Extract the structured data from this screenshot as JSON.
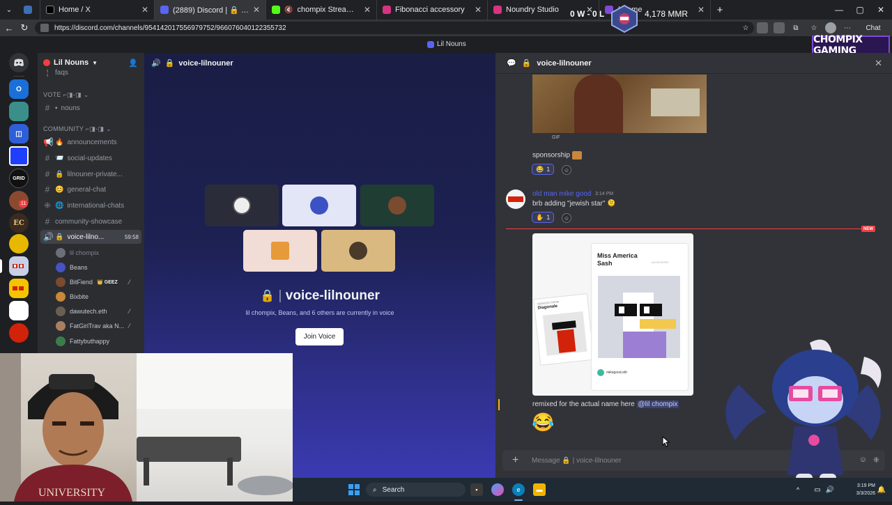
{
  "browser": {
    "tabs": [
      {
        "title": "Home / X",
        "color": "#000000"
      },
      {
        "title": "(2889) Discord | 🔒 | voice-lilnoun",
        "color": "#5865f2"
      },
      {
        "title": "chompix Stream - Watch Live",
        "color": "#53fc18"
      },
      {
        "title": "Fibonacci accessory",
        "color": "#d63384"
      },
      {
        "title": "Noundry Studio",
        "color": "#d63384"
      },
      {
        "title": "/ Home",
        "color": "#7d4bd6"
      }
    ],
    "url": "https://discord.com/channels/954142017556979752/966076040122355732"
  },
  "stream_overlay": {
    "win_loss": "0 W - 0 L",
    "mmr": "4,178 MMR",
    "brand": "CHOMPIX GAMING"
  },
  "discord": {
    "top_title": "Lil Nouns",
    "server_name": "Lil Nouns",
    "sidebar": {
      "partial_channel": "faqs",
      "categories": [
        "VOTE ⌐◨-◨",
        "COMMUNITY ⌐◨-◨"
      ],
      "channels": [
        {
          "label": "nouns",
          "icon": "#"
        },
        {
          "label": "announcements",
          "icon": "📢"
        },
        {
          "label": "social-updates",
          "icon": "#"
        },
        {
          "label": "lilnouner-private...",
          "icon": "#"
        },
        {
          "label": "general-chat",
          "icon": "#"
        },
        {
          "label": "international-chats",
          "icon": "#"
        },
        {
          "label": "community-showcase",
          "icon": "#"
        },
        {
          "label": "voice-lilno...",
          "icon": "🔊",
          "time": "59:58"
        }
      ],
      "voice_users": [
        {
          "name": "lil chompix",
          "color": "#6d6f78"
        },
        {
          "name": "Beans",
          "color": "#4752c4"
        },
        {
          "name": "BitFiend",
          "badge": "👑 GEEZ",
          "color": "#7a4b2e"
        },
        {
          "name": "Bixbite",
          "color": "#c9873a"
        },
        {
          "name": "dawutech.eth",
          "color": "#6a5f52"
        },
        {
          "name": "FatGirlTrav aka N...",
          "color": "#a97f62"
        },
        {
          "name": "Fattybuthappy",
          "color": "#3a7d4a"
        }
      ]
    },
    "voice_stage": {
      "header": "voice-lilnouner",
      "title": "voice-lilnouner",
      "subtitle": "lil chompix, Beans, and 6 others are currently in voice",
      "join_label": "Join Voice"
    },
    "chat": {
      "header": "voice-lilnouner",
      "gif_label": "GIF",
      "message_1": "sponsorship",
      "reaction_1_count": "1",
      "author_2": "old man mike good",
      "time_2": "3:14 PM",
      "message_2": "brb adding \"jewish star\"",
      "reaction_2_count": "1",
      "new_badge": "NEW",
      "card": {
        "title": "Miss America Sash",
        "remixed_from": "REMIXED FROM",
        "remix_name": "Diagonale",
        "user": "mikegood.eth",
        "accessory": "ACCESSORY"
      },
      "message_3": "remixed for the actual name here",
      "mention": "@lil chompix",
      "emoji_3": "😂",
      "input_placeholder": "Message 🔒 | voice-lilnouner"
    }
  },
  "taskbar": {
    "search": "Search",
    "time": "3:19 PM",
    "date": "3/3/2026"
  }
}
